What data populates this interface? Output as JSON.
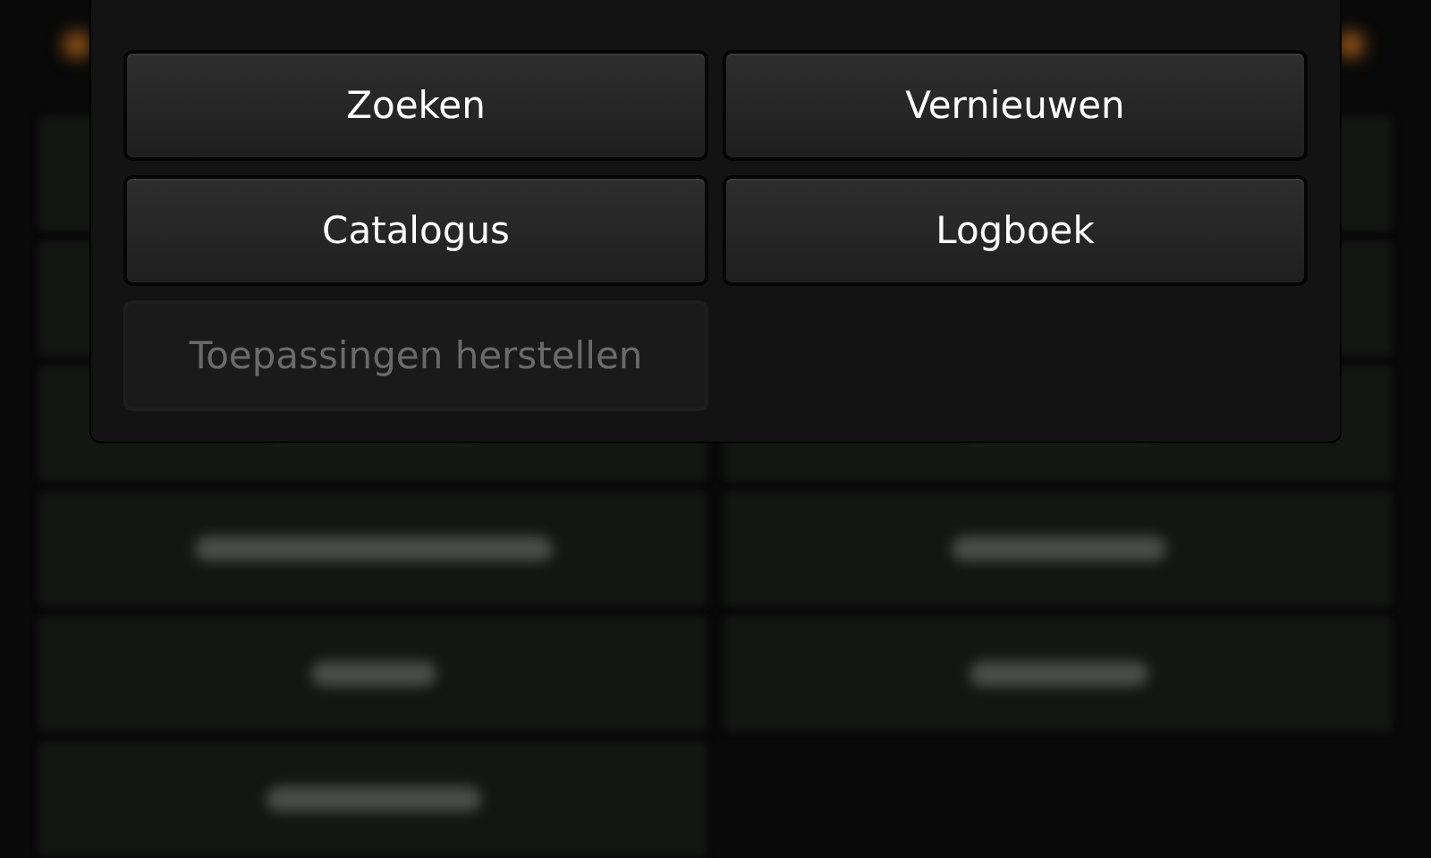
{
  "background_tiles": [
    {
      "kind": "blurred"
    },
    {
      "kind": "blurred"
    },
    {
      "kind": "blurred"
    },
    {
      "kind": "blurred"
    },
    {
      "kind": "blurred"
    },
    {
      "kind": "blurred"
    },
    {
      "kind": "blurred"
    },
    {
      "kind": "blurred"
    },
    {
      "kind": "blurred"
    },
    {
      "kind": "blurred"
    },
    {
      "kind": "blurred"
    }
  ],
  "menu": {
    "buttons": [
      {
        "label": "Zoeken",
        "disabled": false
      },
      {
        "label": "Vernieuwen",
        "disabled": false
      },
      {
        "label": "Catalogus",
        "disabled": false
      },
      {
        "label": "Logboek",
        "disabled": false
      },
      {
        "label": "Toepassingen herstellen",
        "disabled": true
      }
    ]
  }
}
